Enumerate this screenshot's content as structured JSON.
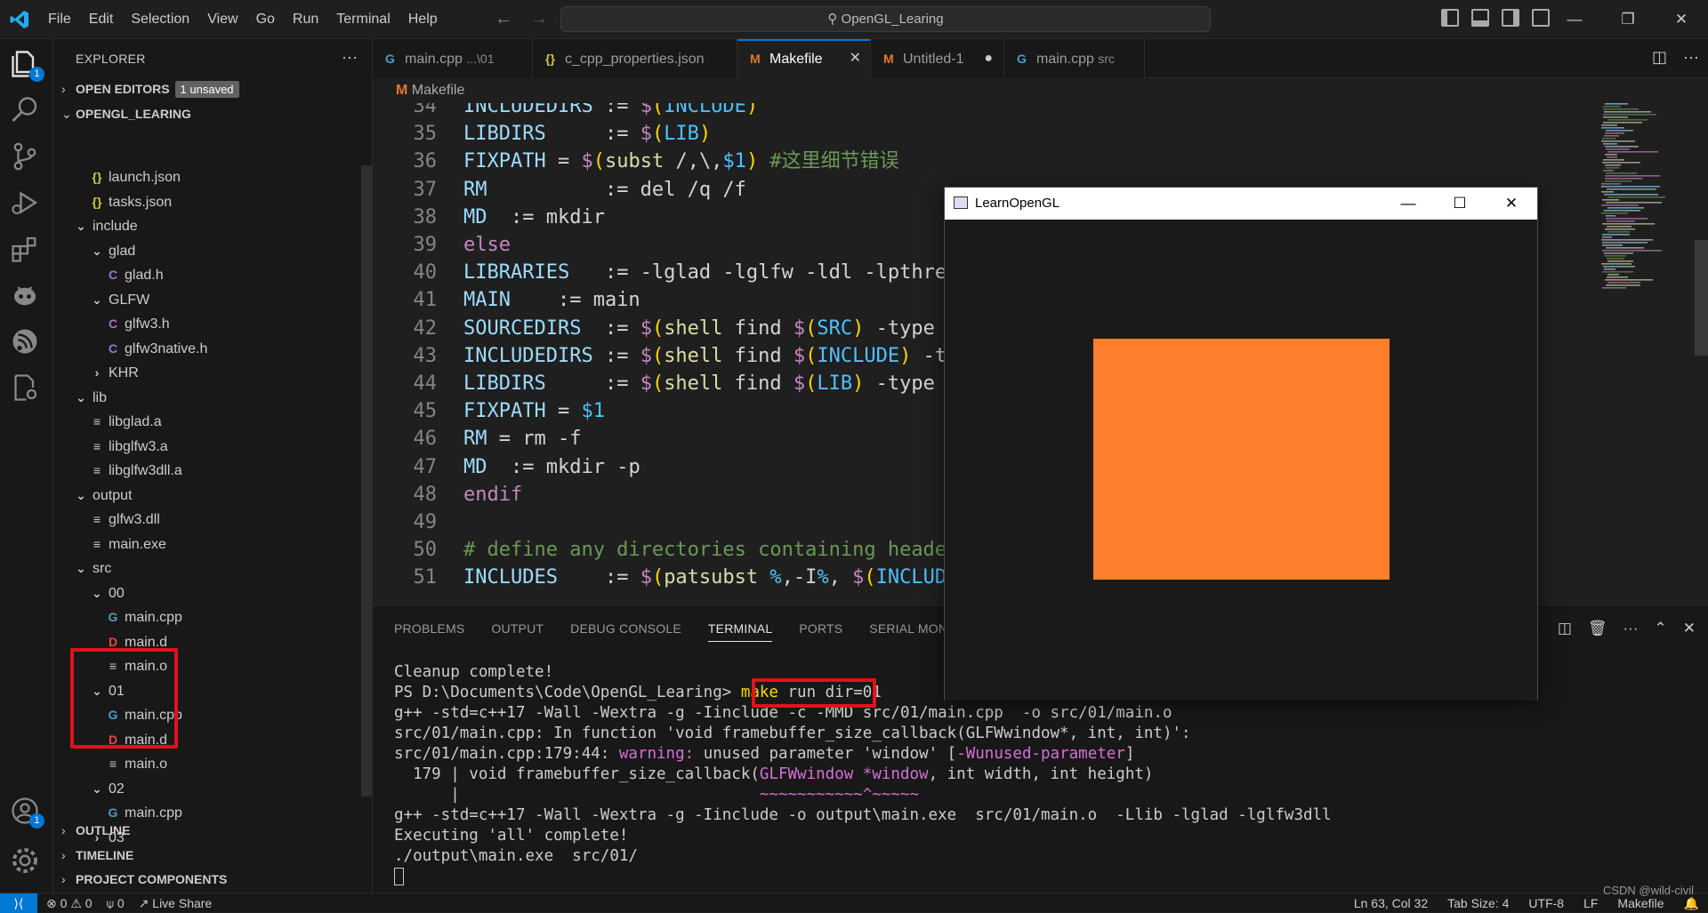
{
  "menu": [
    "File",
    "Edit",
    "Selection",
    "View",
    "Go",
    "Run",
    "Terminal",
    "Help"
  ],
  "command_center": "OpenGL_Learing",
  "explorer": {
    "title": "EXPLORER",
    "open_editors": "OPEN EDITORS",
    "unsaved_badge": "1 unsaved",
    "root": "OPENGL_LEARING",
    "outline": "OUTLINE",
    "timeline": "TIMELINE",
    "project_components": "PROJECT COMPONENTS",
    "tree": [
      {
        "label": "launch.json",
        "icon": "{}",
        "type": "json"
      },
      {
        "label": "tasks.json",
        "icon": "{}",
        "type": "json"
      },
      {
        "label": "include",
        "icon": "v",
        "type": "folder-open"
      },
      {
        "label": "glad",
        "icon": "v",
        "type": "folder-open"
      },
      {
        "label": "glad.h",
        "icon": "C",
        "type": "c"
      },
      {
        "label": "GLFW",
        "icon": "v",
        "type": "folder-open"
      },
      {
        "label": "glfw3.h",
        "icon": "C",
        "type": "c"
      },
      {
        "label": "glfw3native.h",
        "icon": "C",
        "type": "c"
      },
      {
        "label": "KHR",
        "icon": ">",
        "type": "folder-closed"
      },
      {
        "label": "lib",
        "icon": "v",
        "type": "folder-open"
      },
      {
        "label": "libglad.a",
        "icon": "≡",
        "type": "txt"
      },
      {
        "label": "libglfw3.a",
        "icon": "≡",
        "type": "txt"
      },
      {
        "label": "libglfw3dll.a",
        "icon": "≡",
        "type": "txt"
      },
      {
        "label": "output",
        "icon": "v",
        "type": "folder-open"
      },
      {
        "label": "glfw3.dll",
        "icon": "≡",
        "type": "txt"
      },
      {
        "label": "main.exe",
        "icon": "≡",
        "type": "txt"
      },
      {
        "label": "src",
        "icon": "v",
        "type": "folder-open"
      },
      {
        "label": "00",
        "icon": "v",
        "type": "folder-open"
      },
      {
        "label": "main.cpp",
        "icon": "G",
        "type": "cpp"
      },
      {
        "label": "main.d",
        "icon": "D",
        "type": "d"
      },
      {
        "label": "main.o",
        "icon": "≡",
        "type": "txt"
      },
      {
        "label": "01",
        "icon": "v",
        "type": "folder-open"
      },
      {
        "label": "main.cpp",
        "icon": "G",
        "type": "cpp"
      },
      {
        "label": "main.d",
        "icon": "D",
        "type": "d"
      },
      {
        "label": "main.o",
        "icon": "≡",
        "type": "txt"
      },
      {
        "label": "02",
        "icon": "v",
        "type": "folder-open"
      },
      {
        "label": "main.cpp",
        "icon": "G",
        "type": "cpp"
      },
      {
        "label": "03",
        "icon": ">",
        "type": "folder-closed"
      }
    ]
  },
  "tabs": [
    {
      "label": "main.cpp",
      "desc": "...\\01",
      "icon": "G"
    },
    {
      "label": "c_cpp_properties.json",
      "desc": "",
      "icon": "{}"
    },
    {
      "label": "Makefile",
      "desc": "",
      "icon": "M"
    },
    {
      "label": "Untitled-1",
      "desc": "",
      "icon": "M"
    },
    {
      "label": "main.cpp",
      "desc": "src",
      "icon": "G"
    }
  ],
  "breadcrumb": "Makefile",
  "code_lines": [
    {
      "n": "34",
      "parts": [
        [
          "k-id",
          "INCLUDEDIRS"
        ],
        [
          "k-pl",
          " := "
        ],
        [
          "k-kw",
          "$"
        ],
        [
          "k-or",
          "("
        ],
        [
          "k-blue",
          "INCLUDE"
        ],
        [
          "k-or",
          ")"
        ]
      ]
    },
    {
      "n": "35",
      "parts": [
        [
          "k-id",
          "LIBDIRS"
        ],
        [
          "k-pl",
          "     := "
        ],
        [
          "k-kw",
          "$"
        ],
        [
          "k-or",
          "("
        ],
        [
          "k-blue",
          "LIB"
        ],
        [
          "k-or",
          ")"
        ]
      ]
    },
    {
      "n": "36",
      "parts": [
        [
          "k-id",
          "FIXPATH"
        ],
        [
          "k-pl",
          " = "
        ],
        [
          "k-kw",
          "$"
        ],
        [
          "k-or",
          "("
        ],
        [
          "k-fn",
          "subst"
        ],
        [
          "k-pl",
          " /,\\,"
        ],
        [
          "k-blue",
          "$1"
        ],
        [
          "k-or",
          ")"
        ],
        [
          "k-cm",
          " #这里细节错误"
        ]
      ]
    },
    {
      "n": "37",
      "parts": [
        [
          "k-id",
          "RM"
        ],
        [
          "k-pl",
          "          := del /q /f"
        ]
      ]
    },
    {
      "n": "38",
      "parts": [
        [
          "k-id",
          "MD"
        ],
        [
          "k-pl",
          "  := mkdir"
        ]
      ]
    },
    {
      "n": "39",
      "parts": [
        [
          "k-kw",
          "else"
        ]
      ]
    },
    {
      "n": "40",
      "parts": [
        [
          "k-id",
          "LIBRARIES"
        ],
        [
          "k-pl",
          "   := -lglad -lglfw -ldl -lpthrea"
        ]
      ]
    },
    {
      "n": "41",
      "parts": [
        [
          "k-id",
          "MAIN"
        ],
        [
          "k-pl",
          "    := main"
        ]
      ]
    },
    {
      "n": "42",
      "parts": [
        [
          "k-id",
          "SOURCEDIRS"
        ],
        [
          "k-pl",
          "  := "
        ],
        [
          "k-kw",
          "$"
        ],
        [
          "k-or",
          "("
        ],
        [
          "k-fn",
          "shell"
        ],
        [
          "k-pl",
          " find "
        ],
        [
          "k-kw",
          "$"
        ],
        [
          "k-or",
          "("
        ],
        [
          "k-blue",
          "SRC"
        ],
        [
          "k-or",
          ")"
        ],
        [
          "k-pl",
          " -type d"
        ]
      ]
    },
    {
      "n": "43",
      "parts": [
        [
          "k-id",
          "INCLUDEDIRS"
        ],
        [
          "k-pl",
          " := "
        ],
        [
          "k-kw",
          "$"
        ],
        [
          "k-or",
          "("
        ],
        [
          "k-fn",
          "shell"
        ],
        [
          "k-pl",
          " find "
        ],
        [
          "k-kw",
          "$"
        ],
        [
          "k-or",
          "("
        ],
        [
          "k-blue",
          "INCLUDE"
        ],
        [
          "k-or",
          ")"
        ],
        [
          "k-pl",
          " -ty"
        ]
      ]
    },
    {
      "n": "44",
      "parts": [
        [
          "k-id",
          "LIBDIRS"
        ],
        [
          "k-pl",
          "     := "
        ],
        [
          "k-kw",
          "$"
        ],
        [
          "k-or",
          "("
        ],
        [
          "k-fn",
          "shell"
        ],
        [
          "k-pl",
          " find "
        ],
        [
          "k-kw",
          "$"
        ],
        [
          "k-or",
          "("
        ],
        [
          "k-blue",
          "LIB"
        ],
        [
          "k-or",
          ")"
        ],
        [
          "k-pl",
          " -type d"
        ]
      ]
    },
    {
      "n": "45",
      "parts": [
        [
          "k-id",
          "FIXPATH"
        ],
        [
          "k-pl",
          " = "
        ],
        [
          "k-blue",
          "$1"
        ]
      ]
    },
    {
      "n": "46",
      "parts": [
        [
          "k-id",
          "RM"
        ],
        [
          "k-pl",
          " = rm -f"
        ]
      ]
    },
    {
      "n": "47",
      "parts": [
        [
          "k-id",
          "MD"
        ],
        [
          "k-pl",
          "  := mkdir -p"
        ]
      ]
    },
    {
      "n": "48",
      "parts": [
        [
          "k-kw",
          "endif"
        ]
      ]
    },
    {
      "n": "49",
      "parts": []
    },
    {
      "n": "50",
      "parts": [
        [
          "k-cm",
          "# define any directories containing header"
        ]
      ]
    },
    {
      "n": "51",
      "parts": [
        [
          "k-id",
          "INCLUDES"
        ],
        [
          "k-pl",
          "    := "
        ],
        [
          "k-kw",
          "$"
        ],
        [
          "k-or",
          "("
        ],
        [
          "k-fn",
          "patsubst"
        ],
        [
          "k-pl",
          " "
        ],
        [
          "k-blue",
          "%"
        ],
        [
          "k-pl",
          ",-I"
        ],
        [
          "k-blue",
          "%"
        ],
        [
          "k-pl",
          ", "
        ],
        [
          "k-kw",
          "$"
        ],
        [
          "k-or",
          "("
        ],
        [
          "k-blue",
          "INCLUDE"
        ]
      ]
    }
  ],
  "panel_tabs": [
    "PROBLEMS",
    "OUTPUT",
    "DEBUG CONSOLE",
    "TERMINAL",
    "PORTS",
    "SERIAL MONITOR"
  ],
  "terminal": {
    "l1": "Cleanup complete!",
    "prompt": "PS D:\\Documents\\Code\\OpenGL_Learing> ",
    "cmd_make": "make",
    "cmd_rest": " run dir=01",
    "l3": "g++ -std=c++17 -Wall -Wextra -g -Iinclude -c -MMD src/01/main.cpp  -o src/01/main.o",
    "l4": "src/01/main.cpp: In function 'void framebuffer_size_callback(GLFWwindow*, int, int)':",
    "l5a": "src/01/main.cpp:179:44: ",
    "l5b": "warning: ",
    "l5c": "unused parameter 'window' [",
    "l5d": "-Wunused-parameter",
    "l5e": "]",
    "l6a": "  179 | void framebuffer_size_callback(",
    "l6b": "GLFWwindow *window",
    "l6c": ", int width, int height)",
    "l7a": "      |                                ",
    "l7b": "~~~~~~~~~~~^~~~~~",
    "l8": "g++ -std=c++17 -Wall -Wextra -g -Iinclude -o output\\main.exe  src/01/main.o  -Llib -lglad -lglfw3dll",
    "l9": "Executing 'all' complete!",
    "l10": "./output\\main.exe  src/01/"
  },
  "gl_window": {
    "title": "LearnOpenGL",
    "quad_color": "#ff7f2f"
  },
  "status": {
    "errors": "0",
    "warnings": "0",
    "ports": "0",
    "live_share": "Live Share",
    "position": "Ln 63, Col 32",
    "tab_size": "Tab Size: 4",
    "encoding": "UTF-8",
    "eol": "LF",
    "language": "Makefile",
    "watermark": "CSDN @wild-civil"
  },
  "colors": {
    "accent": "#0078d4",
    "highlight_box": "#e3111b",
    "quad": "#ff7f2f"
  }
}
